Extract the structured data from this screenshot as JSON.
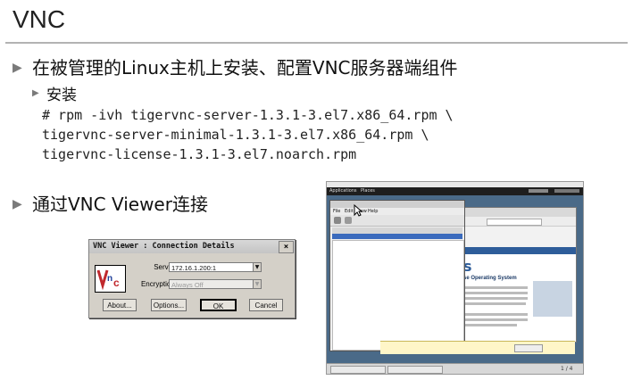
{
  "slide": {
    "title": "VNC",
    "bullet1": "在被管理的Linux主机上安装、配置VNC服务器端组件",
    "sub_bullet": "安装",
    "code_lines": [
      "# rpm -ivh tigervnc-server-1.3.1-3.el7.x86_64.rpm \\",
      "tigervnc-server-minimal-1.3.1-3.el7.x86_64.rpm \\",
      "tigervnc-license-1.3.1-3.el7.noarch.rpm"
    ],
    "bullet2": "通过VNC Viewer连接"
  },
  "vnc_dialog": {
    "title": "VNC Viewer : Connection Details",
    "close_label": "×",
    "logo_text": "Vnc",
    "server_label": "Server:",
    "server_value": "172.16.1.200:1",
    "encryption_label": "Encryption:",
    "encryption_value": "Always Off",
    "buttons": {
      "about": "About...",
      "options": "Options...",
      "ok": "OK",
      "cancel": "Cancel"
    }
  },
  "screenshot": {
    "top_menu": {
      "applications": "Applications",
      "places": "Places"
    },
    "vmm_window": {
      "menu": [
        "File",
        "Edit",
        "View",
        "Help"
      ]
    },
    "browser": {
      "heading": "se Operating System"
    },
    "taskbar": {
      "page_indicator": "1 / 4"
    }
  },
  "colors": {
    "bullet_triangle": "#7a7a7a",
    "title_rule": "#b3b3b3",
    "dialog_face": "#d4d0c8",
    "desktop_bg": "#4a6a88",
    "accent_blue": "#2e5d9a"
  }
}
